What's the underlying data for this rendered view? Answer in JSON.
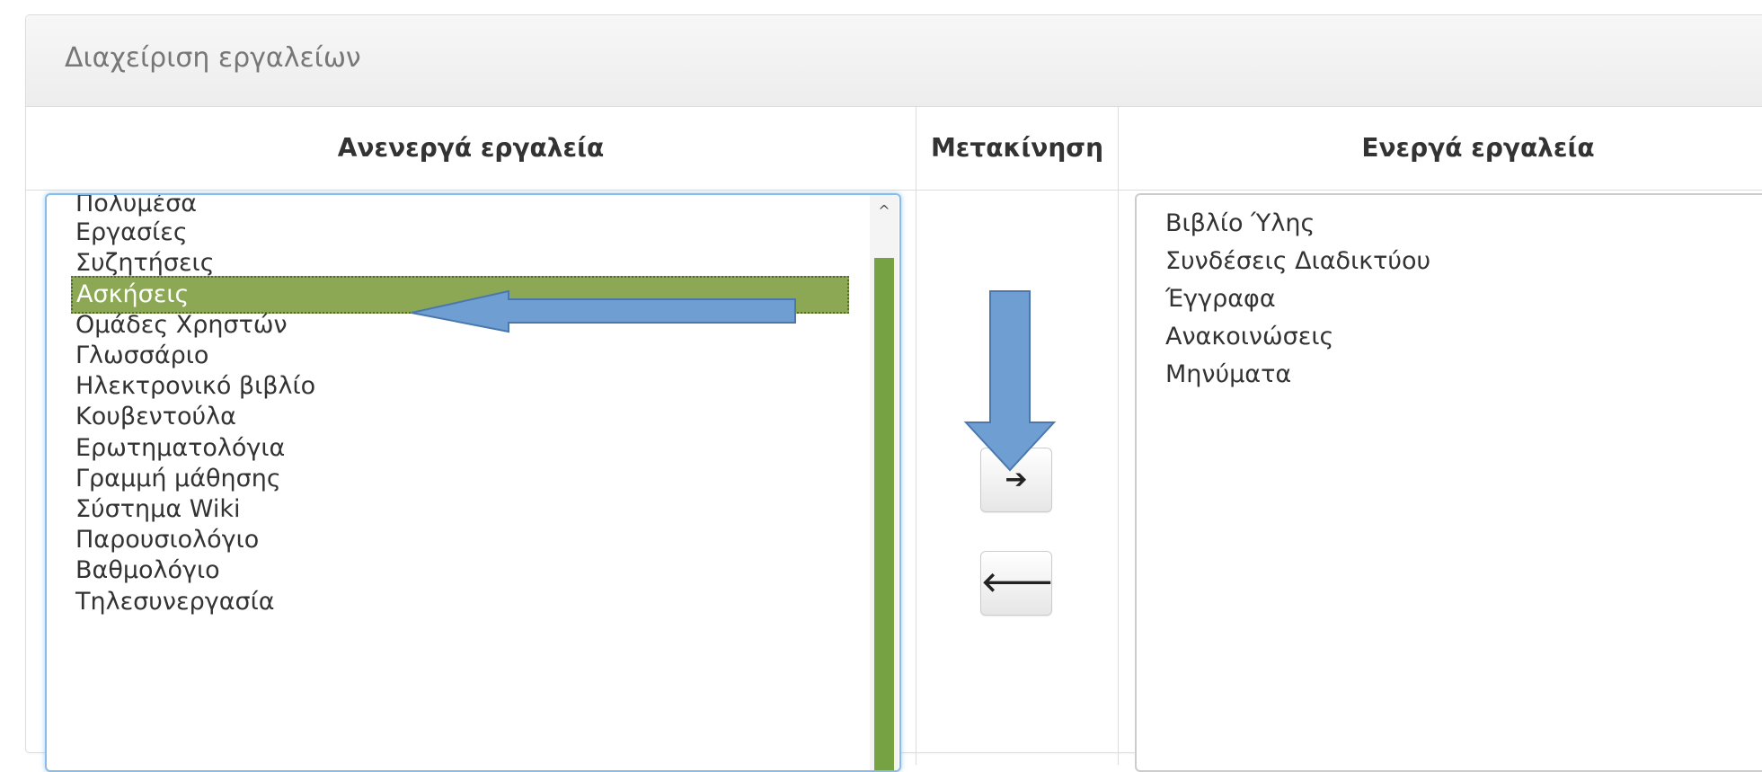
{
  "panel": {
    "title": "Διαχείριση εργαλείων"
  },
  "columns": {
    "inactive": "Ανενεργά εργαλεία",
    "move": "Μετακίνηση",
    "active": "Ενεργά εργαλεία"
  },
  "inactive_tools": [
    "Πολυμέσα",
    "Εργασίες",
    "Συζητήσεις",
    "Ασκήσεις",
    "Ομάδες Χρηστών",
    "Γλωσσάριο",
    "Ηλεκτρονικό βιβλίο",
    "Κουβεντούλα",
    "Ερωτηματολόγια",
    "Γραμμή μάθησης",
    "Σύστημα Wiki",
    "Παρουσιολόγιο",
    "Βαθμολόγιο",
    "Τηλεσυνεργασία"
  ],
  "selected_tool": "Ασκήσεις",
  "active_tools": [
    "Βιβλίο Ύλης",
    "Συνδέσεις Διαδικτύου",
    "Έγγραφα",
    "Ανακοινώσεις",
    "Μηνύματα"
  ],
  "buttons": {
    "move_right": "➔",
    "move_left": "🡐"
  },
  "scroll_up_glyph": "^",
  "icons": {
    "move_right": "arrow-right-icon",
    "move_left": "arrow-left-icon",
    "annotation_left": "annotation-arrow-left",
    "annotation_down": "annotation-arrow-down"
  },
  "colors": {
    "selection": "#8ca855",
    "scroll_thumb": "#76a244",
    "annotation_arrow": "#6f9fd2",
    "focus_border": "#8bbbe8"
  }
}
